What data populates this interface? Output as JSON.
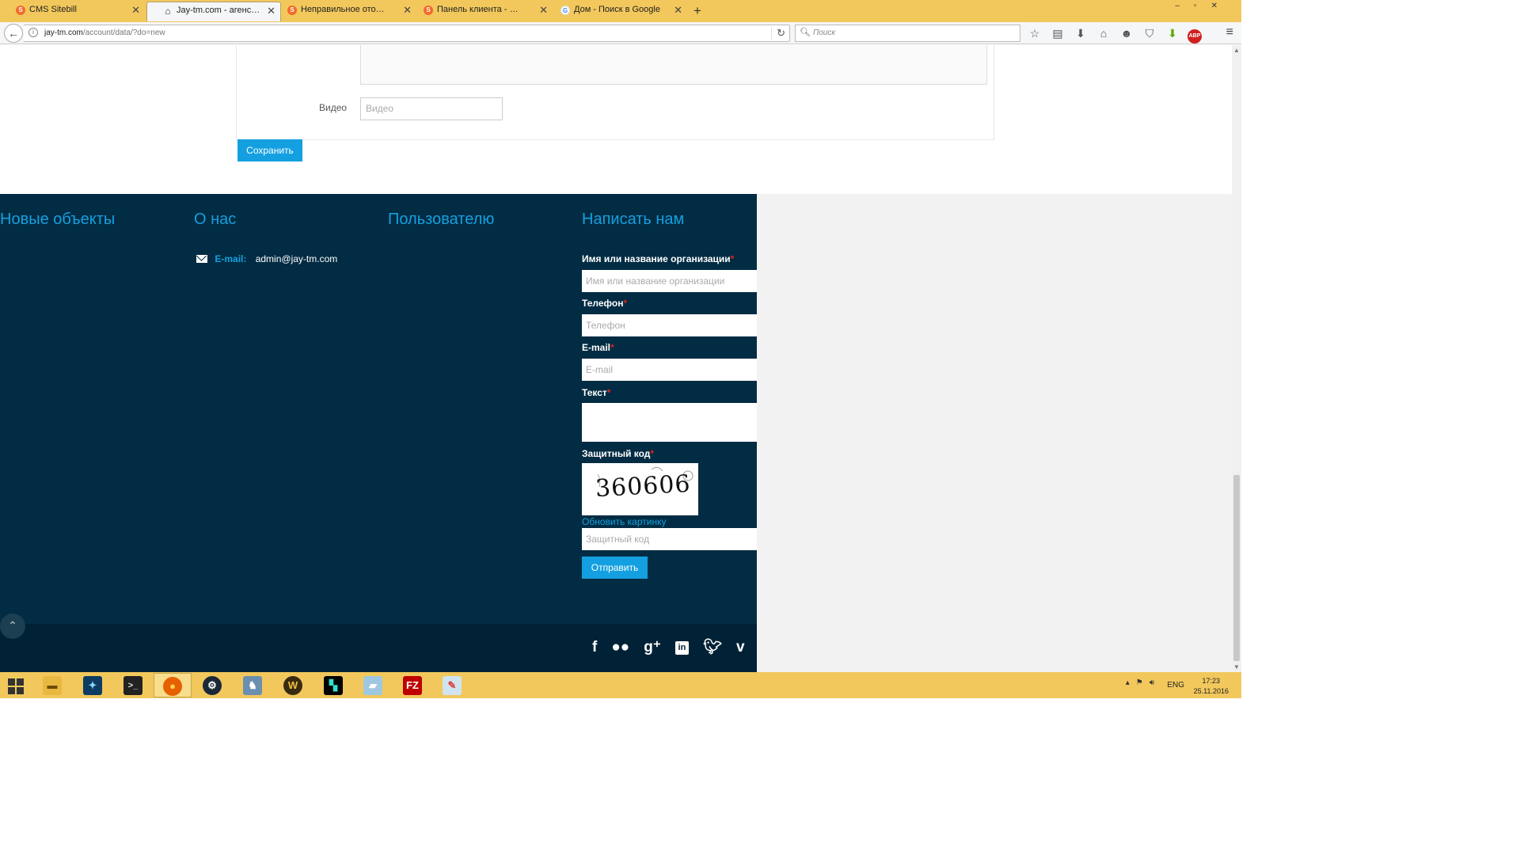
{
  "browser": {
    "tabs": [
      {
        "label": "CMS Sitebill",
        "favicon": "sitebill-icon",
        "active": false
      },
      {
        "label": "Jay-tm.com - агенство не...",
        "favicon": "home-icon",
        "active": true
      },
      {
        "label": "Неправильное отображе...",
        "favicon": "sitebill-icon",
        "active": false
      },
      {
        "label": "Панель клиента - CMS Si...",
        "favicon": "sitebill-icon",
        "active": false
      },
      {
        "label": "Дом - Поиск в Google",
        "favicon": "google-icon",
        "active": false
      }
    ],
    "url_domain": "jay-tm.com",
    "url_path": "/account/data/?do=new",
    "search_placeholder": "Поиск"
  },
  "form": {
    "video_label": "Видео",
    "video_placeholder": "Видео",
    "save_label": "Сохранить"
  },
  "footer": {
    "headings": [
      "Новые объекты",
      "О нас",
      "Пользователю",
      "Написать нам"
    ],
    "email_label": "E-mail:",
    "email_value": "admin@jay-tm.com",
    "contact": {
      "name_label": "Имя или название организации",
      "name_placeholder": "Имя или название организации",
      "phone_label": "Телефон",
      "phone_placeholder": "Телефон",
      "email_label": "E-mail",
      "email_placeholder": "E-mail",
      "text_label": "Текст",
      "captcha_label": "Защитный код",
      "captcha_code": "360606",
      "refresh_label": "Обновить картинку",
      "captcha_placeholder": "Защитный код",
      "send_label": "Отправить",
      "required_mark": "*"
    },
    "social": [
      "facebook-icon",
      "flickr-icon",
      "google-plus-icon",
      "linkedin-icon",
      "twitter-icon",
      "vimeo-icon"
    ]
  },
  "taskbar": {
    "language": "ENG",
    "time": "17:23",
    "date": "25.11.2016"
  },
  "colors": {
    "accent": "#14a0e0",
    "footer_bg": "#022c43",
    "required": "#e02020",
    "chrome": "#f2c85c"
  }
}
